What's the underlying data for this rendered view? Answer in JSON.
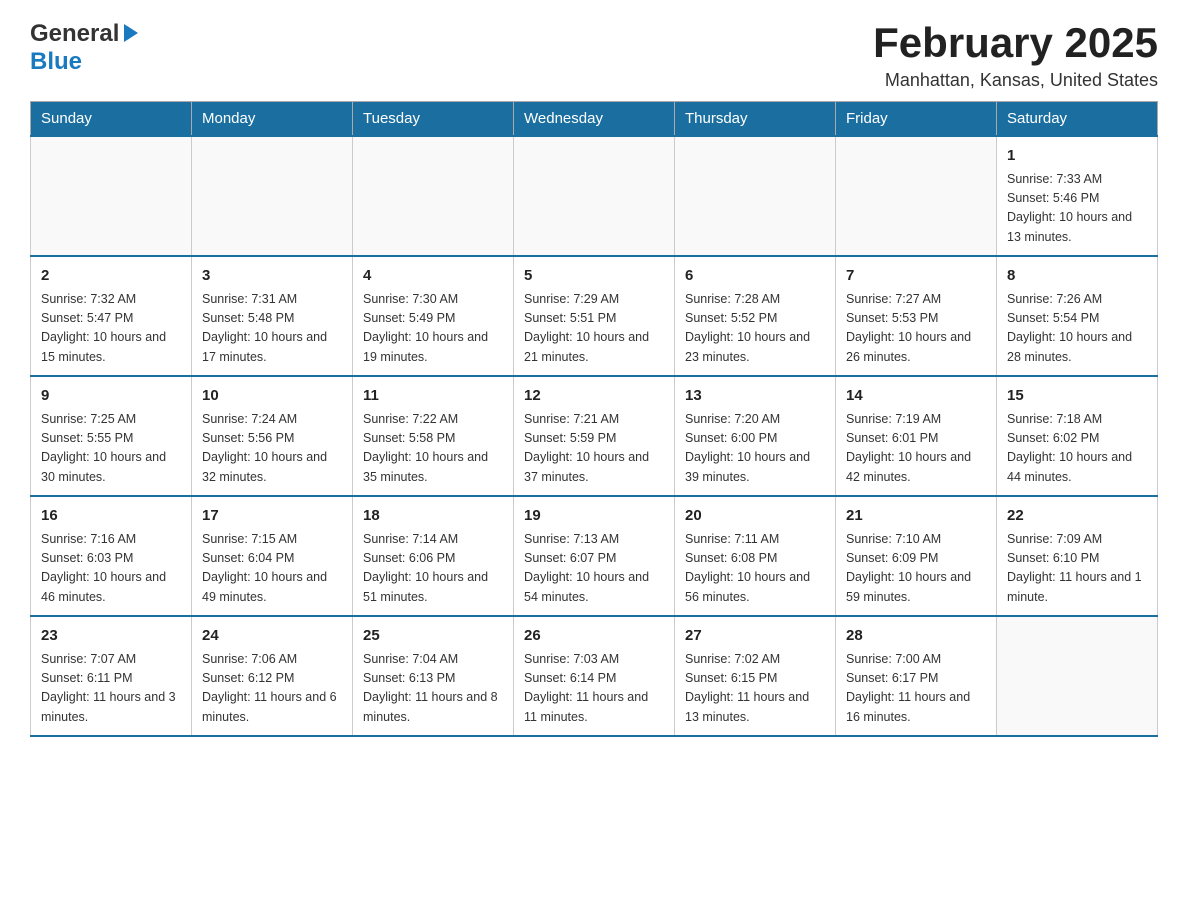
{
  "header": {
    "logo_general": "General",
    "logo_blue": "Blue",
    "title": "February 2025",
    "location": "Manhattan, Kansas, United States"
  },
  "weekdays": [
    "Sunday",
    "Monday",
    "Tuesday",
    "Wednesday",
    "Thursday",
    "Friday",
    "Saturday"
  ],
  "weeks": [
    [
      {
        "day": "",
        "info": ""
      },
      {
        "day": "",
        "info": ""
      },
      {
        "day": "",
        "info": ""
      },
      {
        "day": "",
        "info": ""
      },
      {
        "day": "",
        "info": ""
      },
      {
        "day": "",
        "info": ""
      },
      {
        "day": "1",
        "info": "Sunrise: 7:33 AM\nSunset: 5:46 PM\nDaylight: 10 hours and 13 minutes."
      }
    ],
    [
      {
        "day": "2",
        "info": "Sunrise: 7:32 AM\nSunset: 5:47 PM\nDaylight: 10 hours and 15 minutes."
      },
      {
        "day": "3",
        "info": "Sunrise: 7:31 AM\nSunset: 5:48 PM\nDaylight: 10 hours and 17 minutes."
      },
      {
        "day": "4",
        "info": "Sunrise: 7:30 AM\nSunset: 5:49 PM\nDaylight: 10 hours and 19 minutes."
      },
      {
        "day": "5",
        "info": "Sunrise: 7:29 AM\nSunset: 5:51 PM\nDaylight: 10 hours and 21 minutes."
      },
      {
        "day": "6",
        "info": "Sunrise: 7:28 AM\nSunset: 5:52 PM\nDaylight: 10 hours and 23 minutes."
      },
      {
        "day": "7",
        "info": "Sunrise: 7:27 AM\nSunset: 5:53 PM\nDaylight: 10 hours and 26 minutes."
      },
      {
        "day": "8",
        "info": "Sunrise: 7:26 AM\nSunset: 5:54 PM\nDaylight: 10 hours and 28 minutes."
      }
    ],
    [
      {
        "day": "9",
        "info": "Sunrise: 7:25 AM\nSunset: 5:55 PM\nDaylight: 10 hours and 30 minutes."
      },
      {
        "day": "10",
        "info": "Sunrise: 7:24 AM\nSunset: 5:56 PM\nDaylight: 10 hours and 32 minutes."
      },
      {
        "day": "11",
        "info": "Sunrise: 7:22 AM\nSunset: 5:58 PM\nDaylight: 10 hours and 35 minutes."
      },
      {
        "day": "12",
        "info": "Sunrise: 7:21 AM\nSunset: 5:59 PM\nDaylight: 10 hours and 37 minutes."
      },
      {
        "day": "13",
        "info": "Sunrise: 7:20 AM\nSunset: 6:00 PM\nDaylight: 10 hours and 39 minutes."
      },
      {
        "day": "14",
        "info": "Sunrise: 7:19 AM\nSunset: 6:01 PM\nDaylight: 10 hours and 42 minutes."
      },
      {
        "day": "15",
        "info": "Sunrise: 7:18 AM\nSunset: 6:02 PM\nDaylight: 10 hours and 44 minutes."
      }
    ],
    [
      {
        "day": "16",
        "info": "Sunrise: 7:16 AM\nSunset: 6:03 PM\nDaylight: 10 hours and 46 minutes."
      },
      {
        "day": "17",
        "info": "Sunrise: 7:15 AM\nSunset: 6:04 PM\nDaylight: 10 hours and 49 minutes."
      },
      {
        "day": "18",
        "info": "Sunrise: 7:14 AM\nSunset: 6:06 PM\nDaylight: 10 hours and 51 minutes."
      },
      {
        "day": "19",
        "info": "Sunrise: 7:13 AM\nSunset: 6:07 PM\nDaylight: 10 hours and 54 minutes."
      },
      {
        "day": "20",
        "info": "Sunrise: 7:11 AM\nSunset: 6:08 PM\nDaylight: 10 hours and 56 minutes."
      },
      {
        "day": "21",
        "info": "Sunrise: 7:10 AM\nSunset: 6:09 PM\nDaylight: 10 hours and 59 minutes."
      },
      {
        "day": "22",
        "info": "Sunrise: 7:09 AM\nSunset: 6:10 PM\nDaylight: 11 hours and 1 minute."
      }
    ],
    [
      {
        "day": "23",
        "info": "Sunrise: 7:07 AM\nSunset: 6:11 PM\nDaylight: 11 hours and 3 minutes."
      },
      {
        "day": "24",
        "info": "Sunrise: 7:06 AM\nSunset: 6:12 PM\nDaylight: 11 hours and 6 minutes."
      },
      {
        "day": "25",
        "info": "Sunrise: 7:04 AM\nSunset: 6:13 PM\nDaylight: 11 hours and 8 minutes."
      },
      {
        "day": "26",
        "info": "Sunrise: 7:03 AM\nSunset: 6:14 PM\nDaylight: 11 hours and 11 minutes."
      },
      {
        "day": "27",
        "info": "Sunrise: 7:02 AM\nSunset: 6:15 PM\nDaylight: 11 hours and 13 minutes."
      },
      {
        "day": "28",
        "info": "Sunrise: 7:00 AM\nSunset: 6:17 PM\nDaylight: 11 hours and 16 minutes."
      },
      {
        "day": "",
        "info": ""
      }
    ]
  ]
}
